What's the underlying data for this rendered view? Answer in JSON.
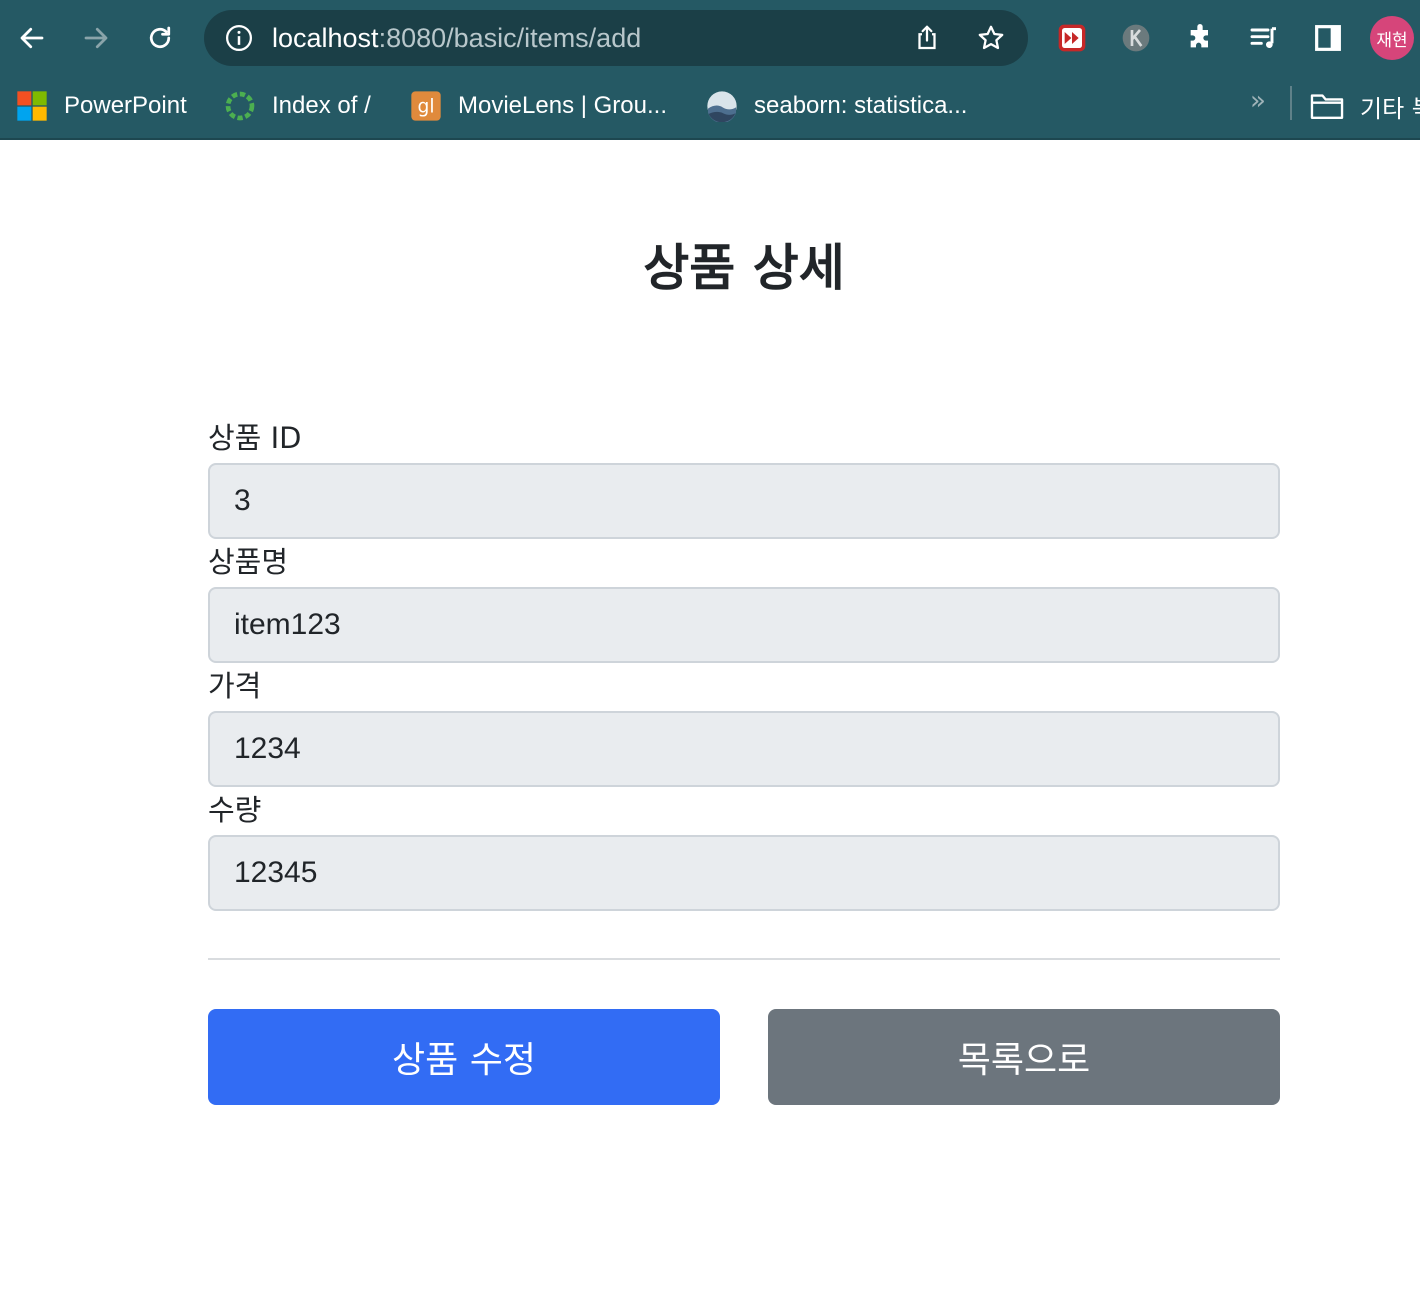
{
  "browser": {
    "url_host": "localhost",
    "url_path": ":8080/basic/items/add",
    "profile_label": "재현",
    "icons": {
      "back": "back-arrow-icon",
      "forward": "forward-arrow-icon",
      "reload": "reload-icon",
      "info": "site-info-icon",
      "share": "share-icon",
      "star": "bookmark-star-icon",
      "extensions": "puzzle-icon",
      "media": "media-queue-icon",
      "sidepanel": "side-panel-icon"
    },
    "bookmarks": [
      {
        "label": "PowerPoint",
        "icon": "powerpoint-icon"
      },
      {
        "label": "Index of /",
        "icon": "ring-icon"
      },
      {
        "label": "MovieLens | Grou...",
        "icon": "grouplens-icon"
      },
      {
        "label": "seaborn: statistica...",
        "icon": "seaborn-icon"
      }
    ],
    "overflow_label": "»",
    "other_bookmarks_label": "기타 북"
  },
  "page": {
    "title": "상품 상세",
    "fields": [
      {
        "label": "상품 ID",
        "value": "3"
      },
      {
        "label": "상품명",
        "value": "item123"
      },
      {
        "label": "가격",
        "value": "1234"
      },
      {
        "label": "수량",
        "value": "12345"
      }
    ],
    "edit_button": "상품 수정",
    "list_button": "목록으로"
  },
  "colors": {
    "chrome": "#255964",
    "primary": "#326cf4",
    "secondary": "#6c757d",
    "input_bg": "#e9ecef"
  }
}
